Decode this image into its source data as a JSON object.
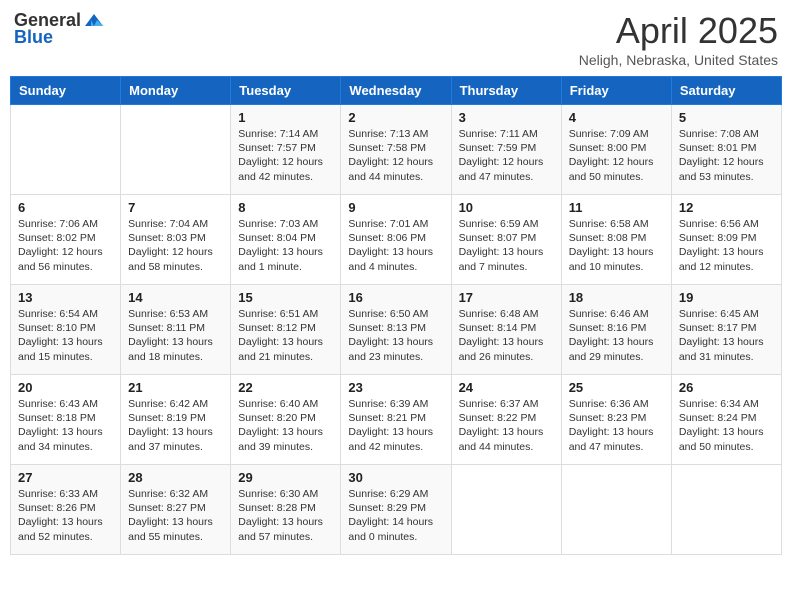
{
  "header": {
    "logo_general": "General",
    "logo_blue": "Blue",
    "month_title": "April 2025",
    "subtitle": "Neligh, Nebraska, United States"
  },
  "weekdays": [
    "Sunday",
    "Monday",
    "Tuesday",
    "Wednesday",
    "Thursday",
    "Friday",
    "Saturday"
  ],
  "weeks": [
    [
      {
        "day": "",
        "info": ""
      },
      {
        "day": "",
        "info": ""
      },
      {
        "day": "1",
        "info": "Sunrise: 7:14 AM\nSunset: 7:57 PM\nDaylight: 12 hours and 42 minutes."
      },
      {
        "day": "2",
        "info": "Sunrise: 7:13 AM\nSunset: 7:58 PM\nDaylight: 12 hours and 44 minutes."
      },
      {
        "day": "3",
        "info": "Sunrise: 7:11 AM\nSunset: 7:59 PM\nDaylight: 12 hours and 47 minutes."
      },
      {
        "day": "4",
        "info": "Sunrise: 7:09 AM\nSunset: 8:00 PM\nDaylight: 12 hours and 50 minutes."
      },
      {
        "day": "5",
        "info": "Sunrise: 7:08 AM\nSunset: 8:01 PM\nDaylight: 12 hours and 53 minutes."
      }
    ],
    [
      {
        "day": "6",
        "info": "Sunrise: 7:06 AM\nSunset: 8:02 PM\nDaylight: 12 hours and 56 minutes."
      },
      {
        "day": "7",
        "info": "Sunrise: 7:04 AM\nSunset: 8:03 PM\nDaylight: 12 hours and 58 minutes."
      },
      {
        "day": "8",
        "info": "Sunrise: 7:03 AM\nSunset: 8:04 PM\nDaylight: 13 hours and 1 minute."
      },
      {
        "day": "9",
        "info": "Sunrise: 7:01 AM\nSunset: 8:06 PM\nDaylight: 13 hours and 4 minutes."
      },
      {
        "day": "10",
        "info": "Sunrise: 6:59 AM\nSunset: 8:07 PM\nDaylight: 13 hours and 7 minutes."
      },
      {
        "day": "11",
        "info": "Sunrise: 6:58 AM\nSunset: 8:08 PM\nDaylight: 13 hours and 10 minutes."
      },
      {
        "day": "12",
        "info": "Sunrise: 6:56 AM\nSunset: 8:09 PM\nDaylight: 13 hours and 12 minutes."
      }
    ],
    [
      {
        "day": "13",
        "info": "Sunrise: 6:54 AM\nSunset: 8:10 PM\nDaylight: 13 hours and 15 minutes."
      },
      {
        "day": "14",
        "info": "Sunrise: 6:53 AM\nSunset: 8:11 PM\nDaylight: 13 hours and 18 minutes."
      },
      {
        "day": "15",
        "info": "Sunrise: 6:51 AM\nSunset: 8:12 PM\nDaylight: 13 hours and 21 minutes."
      },
      {
        "day": "16",
        "info": "Sunrise: 6:50 AM\nSunset: 8:13 PM\nDaylight: 13 hours and 23 minutes."
      },
      {
        "day": "17",
        "info": "Sunrise: 6:48 AM\nSunset: 8:14 PM\nDaylight: 13 hours and 26 minutes."
      },
      {
        "day": "18",
        "info": "Sunrise: 6:46 AM\nSunset: 8:16 PM\nDaylight: 13 hours and 29 minutes."
      },
      {
        "day": "19",
        "info": "Sunrise: 6:45 AM\nSunset: 8:17 PM\nDaylight: 13 hours and 31 minutes."
      }
    ],
    [
      {
        "day": "20",
        "info": "Sunrise: 6:43 AM\nSunset: 8:18 PM\nDaylight: 13 hours and 34 minutes."
      },
      {
        "day": "21",
        "info": "Sunrise: 6:42 AM\nSunset: 8:19 PM\nDaylight: 13 hours and 37 minutes."
      },
      {
        "day": "22",
        "info": "Sunrise: 6:40 AM\nSunset: 8:20 PM\nDaylight: 13 hours and 39 minutes."
      },
      {
        "day": "23",
        "info": "Sunrise: 6:39 AM\nSunset: 8:21 PM\nDaylight: 13 hours and 42 minutes."
      },
      {
        "day": "24",
        "info": "Sunrise: 6:37 AM\nSunset: 8:22 PM\nDaylight: 13 hours and 44 minutes."
      },
      {
        "day": "25",
        "info": "Sunrise: 6:36 AM\nSunset: 8:23 PM\nDaylight: 13 hours and 47 minutes."
      },
      {
        "day": "26",
        "info": "Sunrise: 6:34 AM\nSunset: 8:24 PM\nDaylight: 13 hours and 50 minutes."
      }
    ],
    [
      {
        "day": "27",
        "info": "Sunrise: 6:33 AM\nSunset: 8:26 PM\nDaylight: 13 hours and 52 minutes."
      },
      {
        "day": "28",
        "info": "Sunrise: 6:32 AM\nSunset: 8:27 PM\nDaylight: 13 hours and 55 minutes."
      },
      {
        "day": "29",
        "info": "Sunrise: 6:30 AM\nSunset: 8:28 PM\nDaylight: 13 hours and 57 minutes."
      },
      {
        "day": "30",
        "info": "Sunrise: 6:29 AM\nSunset: 8:29 PM\nDaylight: 14 hours and 0 minutes."
      },
      {
        "day": "",
        "info": ""
      },
      {
        "day": "",
        "info": ""
      },
      {
        "day": "",
        "info": ""
      }
    ]
  ]
}
